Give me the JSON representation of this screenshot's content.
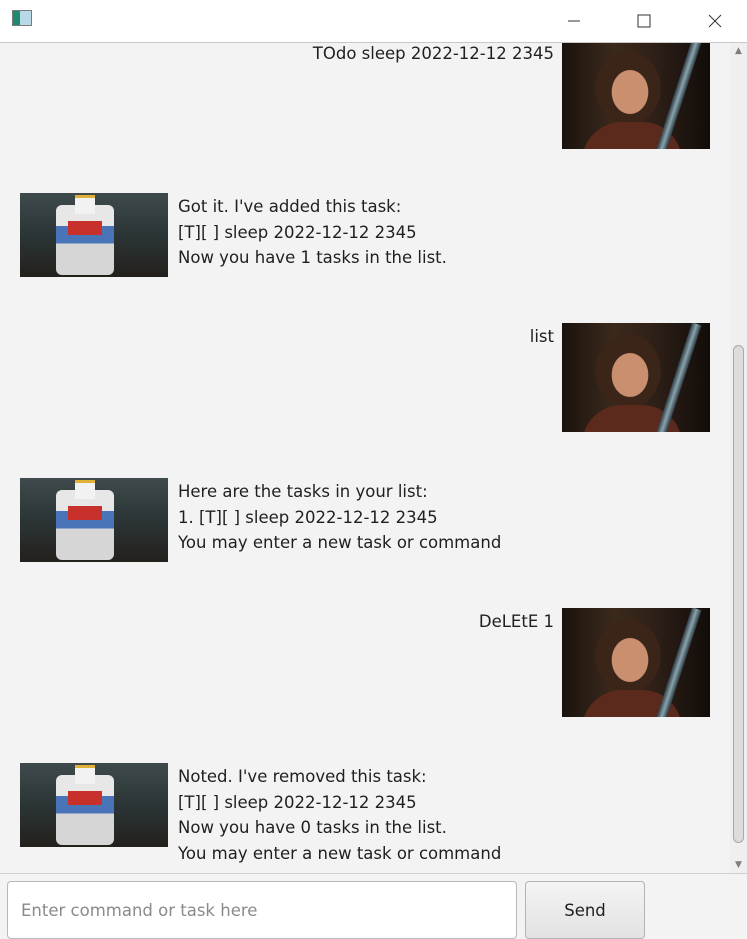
{
  "window": {
    "app_icon": "java-app-icon",
    "controls": [
      "minimize-icon",
      "maximize-icon",
      "close-icon"
    ]
  },
  "chat": {
    "messages": [
      {
        "sender": "user",
        "lines": [
          "TOdo sleep 2022-12-12 2345"
        ]
      },
      {
        "sender": "bot",
        "lines": [
          "Got it. I've added this task:",
          "[T][ ] sleep 2022-12-12 2345",
          "Now you have 1 tasks in the list."
        ]
      },
      {
        "sender": "user",
        "lines": [
          "list"
        ]
      },
      {
        "sender": "bot",
        "lines": [
          "Here are the tasks in your list:",
          "1. [T][ ] sleep 2022-12-12 2345",
          "You may enter a new task or command"
        ]
      },
      {
        "sender": "user",
        "lines": [
          "DeLEtE 1"
        ]
      },
      {
        "sender": "bot",
        "lines": [
          "Noted. I've removed this task:",
          "[T][ ] sleep 2022-12-12 2345",
          "Now you have 0 tasks in the list.",
          "You may enter a new task or command"
        ]
      }
    ]
  },
  "input": {
    "placeholder": "Enter command or task here",
    "value": ""
  },
  "send_button": {
    "label": "Send"
  }
}
